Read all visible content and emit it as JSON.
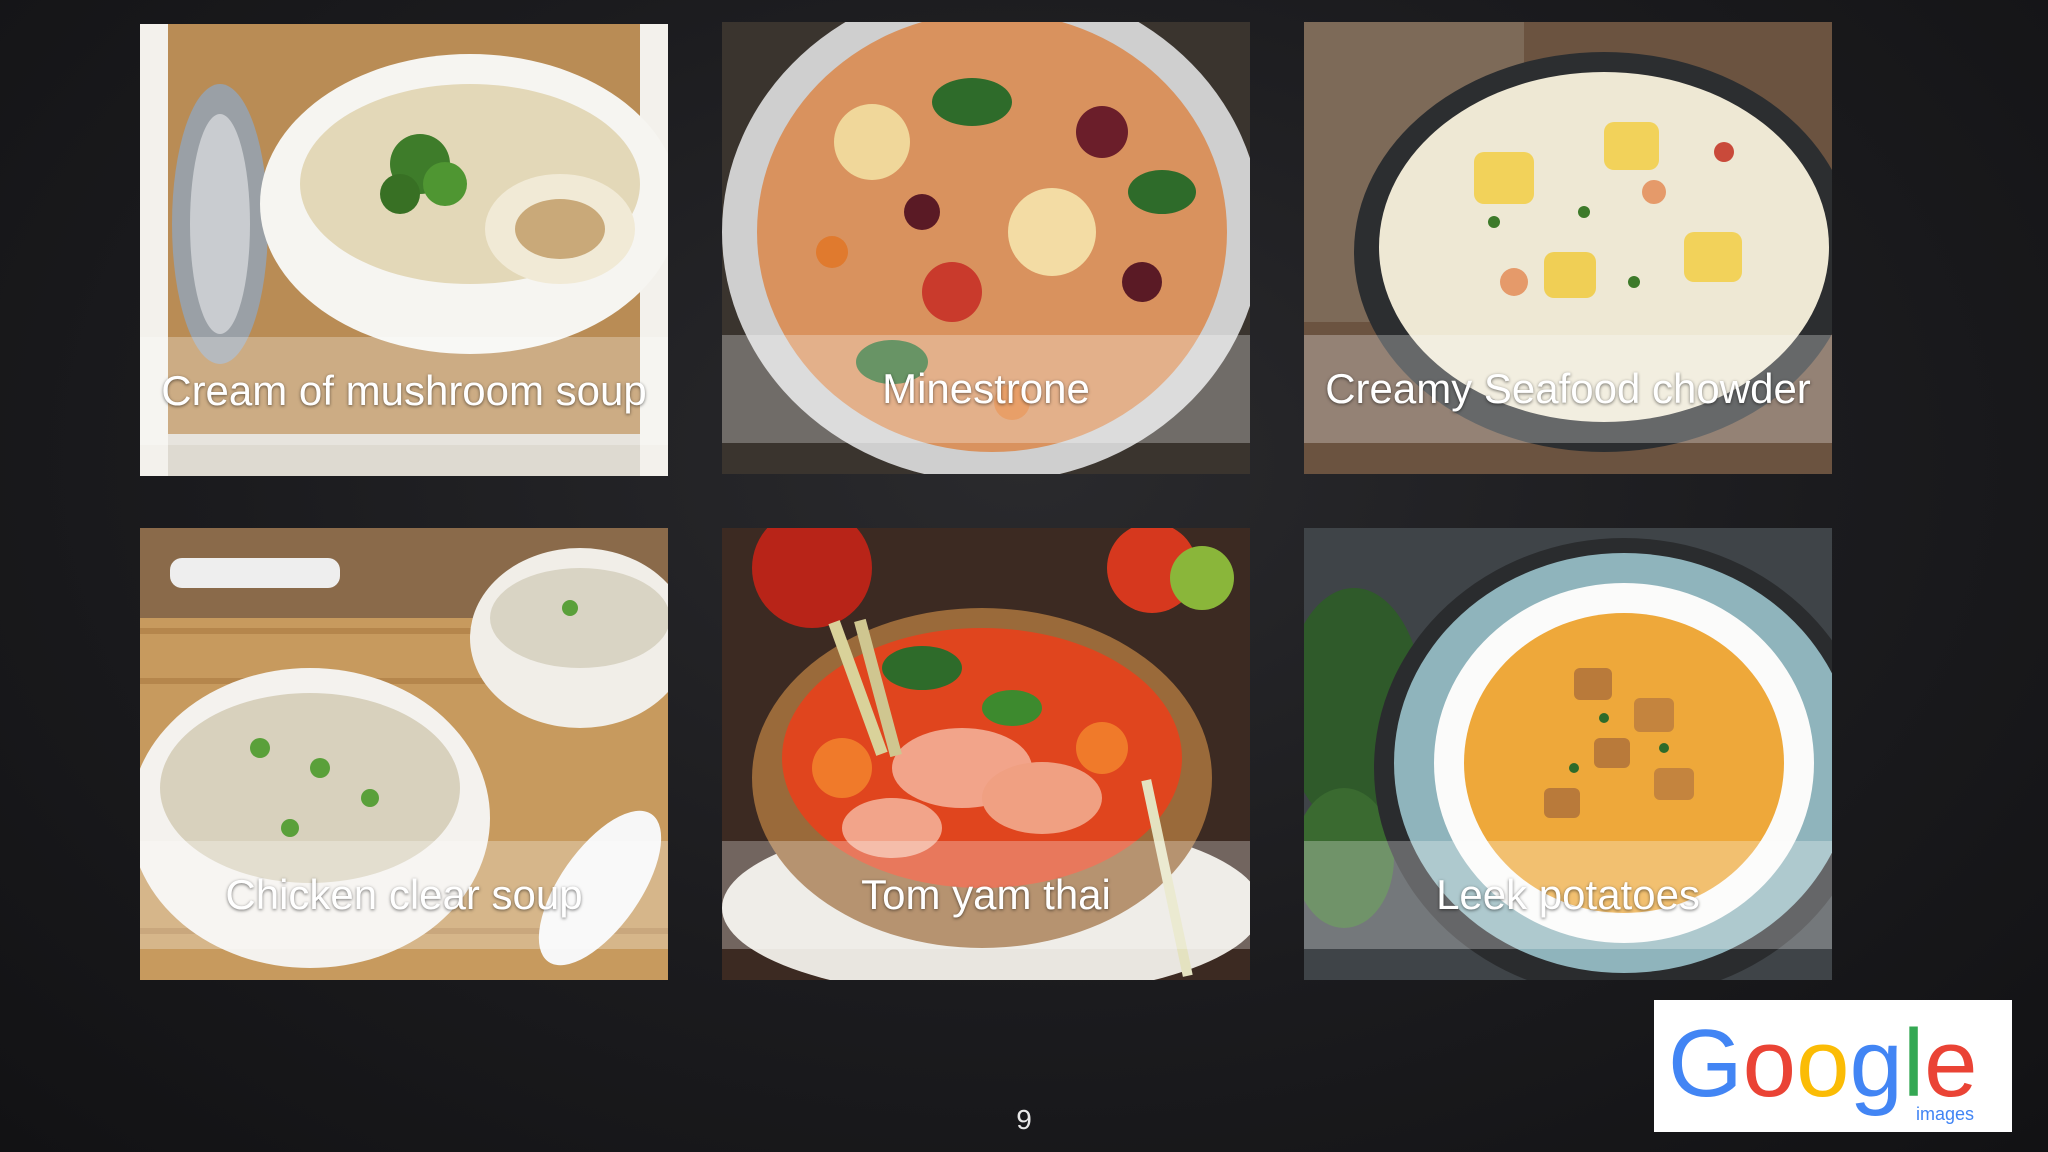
{
  "slide": {
    "page_number": "9",
    "tiles": [
      {
        "caption": "Cream of mushroom soup",
        "image": "mushroom-soup-photo"
      },
      {
        "caption": "Minestrone",
        "image": "minestrone-photo"
      },
      {
        "caption": "Creamy Seafood chowder",
        "image": "seafood-chowder-photo"
      },
      {
        "caption": "Chicken clear soup",
        "image": "chicken-clear-soup-photo"
      },
      {
        "caption": "Tom yam thai",
        "image": "tom-yam-photo"
      },
      {
        "caption": "Leek potatoes",
        "image": "leek-potato-soup-photo"
      }
    ],
    "logo": {
      "word": "Google",
      "sub": "images",
      "colors": {
        "blue": "#4285F4",
        "red": "#EA4335",
        "yellow": "#FBBC05",
        "green": "#34A853"
      }
    }
  },
  "colors": {
    "background": "#1c1c1f",
    "caption_band": "rgba(255,255,255,0.28)",
    "caption_text": "#ffffff"
  }
}
